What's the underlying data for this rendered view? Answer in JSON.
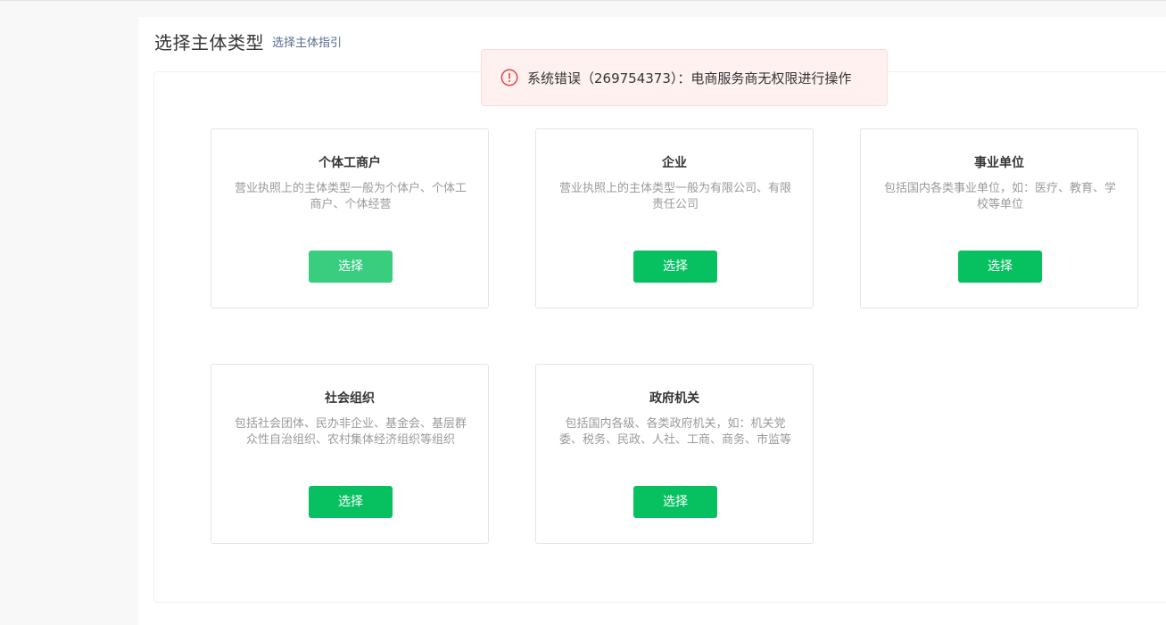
{
  "header": {
    "title": "选择主体类型",
    "guide_link": "选择主体指引"
  },
  "cards": [
    {
      "title": "个体工商户",
      "description": "营业执照上的主体类型一般为个体户、个体工商户、个体经营",
      "button_label": "选择"
    },
    {
      "title": "企业",
      "description": "营业执照上的主体类型一般为有限公司、有限责任公司",
      "button_label": "选择"
    },
    {
      "title": "事业单位",
      "description": "包括国内各类事业单位，如：医疗、教育、学校等单位",
      "button_label": "选择"
    },
    {
      "title": "社会组织",
      "description": "包括社会团体、民办非企业、基金会、基层群众性自治组织、农村集体经济组织等组织",
      "button_label": "选择"
    },
    {
      "title": "政府机关",
      "description": "包括国内各级、各类政府机关，如：机关党委、税务、民政、人社、工商、商务、市监等",
      "button_label": "选择"
    }
  ],
  "toast": {
    "icon": "error-circle-icon",
    "message": "系统错误（269754373）：电商服务商无权限进行操作"
  },
  "colors": {
    "accent": "#07c160",
    "accent_hover": "#38cd7f",
    "link": "#576b95",
    "error": "#e64340"
  }
}
